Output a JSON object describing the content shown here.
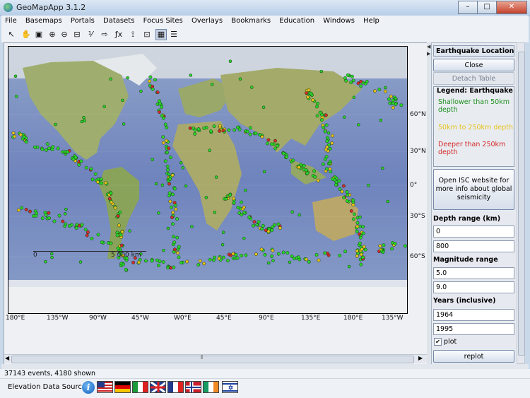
{
  "window": {
    "title": "GeoMapApp 3.1.2",
    "minimize": "–",
    "maximize": "□",
    "close": "✕"
  },
  "menu": [
    "File",
    "Basemaps",
    "Portals",
    "Datasets",
    "Focus Sites",
    "Overlays",
    "Bookmarks",
    "Education",
    "Windows",
    "Help"
  ],
  "toolbar": [
    {
      "name": "select-tool-icon",
      "glyph": "↖"
    },
    {
      "name": "pan-hand-icon",
      "glyph": "✋"
    },
    {
      "name": "save-icon",
      "glyph": "▣"
    },
    {
      "name": "zoom-in-icon",
      "glyph": "⊕"
    },
    {
      "name": "zoom-out-icon",
      "glyph": "⊖"
    },
    {
      "name": "profile-tool-icon",
      "glyph": "⊟"
    },
    {
      "name": "measure-tool-icon",
      "glyph": "⅟"
    },
    {
      "name": "digitize-tool-icon",
      "glyph": "⇨"
    },
    {
      "name": "function-tool-icon",
      "glyph": "ƒx"
    },
    {
      "name": "fork-tool-icon",
      "glyph": "⟟"
    },
    {
      "name": "contour-tool-icon",
      "glyph": "⊡"
    },
    {
      "name": "grid-tool-icon",
      "glyph": "▦"
    },
    {
      "name": "layers-list-icon",
      "glyph": "☰"
    }
  ],
  "map": {
    "lon_labels": [
      "180°E",
      "135°W",
      "90°W",
      "45°W",
      "W0°E",
      "45°E",
      "90°E",
      "135°E",
      "180°E",
      "135°W"
    ],
    "lat_labels": [
      "60°N",
      "30°N",
      "0°",
      "30°S",
      "60°S"
    ],
    "scale_label": "5 000 km",
    "scale_zero": "0"
  },
  "panel": {
    "header": "Earthquake Locations an...",
    "close_label": "Close",
    "detach_label": "Detach Table",
    "legend_title": "Legend: Earthquake Foci",
    "legend_shallow": "Shallower than 50km depth",
    "legend_mid": "50km to 250km depth",
    "legend_deep": "Deeper than 250km depth",
    "colors": {
      "shallow": "#1f8f1f",
      "mid": "#e8c21a",
      "deep": "#d42a2a"
    },
    "isc_label": "Open ISC website for more info about global seismicity",
    "depth_label": "Depth range (km)",
    "depth_min": "0",
    "depth_max": "800",
    "mag_label": "Magnitude range",
    "mag_min": "5.0",
    "mag_max": "9.0",
    "years_label": "Years (inclusive)",
    "year_min": "1964",
    "year_max": "1995",
    "plot_label": "plot",
    "replot_label": "replot"
  },
  "status": "37143 events, 4180 shown",
  "footer": {
    "elevation_label": "Elevation Data Sources",
    "flags": [
      "us-flag-icon",
      "germany-flag-icon",
      "italy-flag-icon",
      "uk-flag-icon",
      "france-flag-icon",
      "norway-flag-icon",
      "ireland-flag-icon",
      "israel-flag-icon"
    ]
  }
}
